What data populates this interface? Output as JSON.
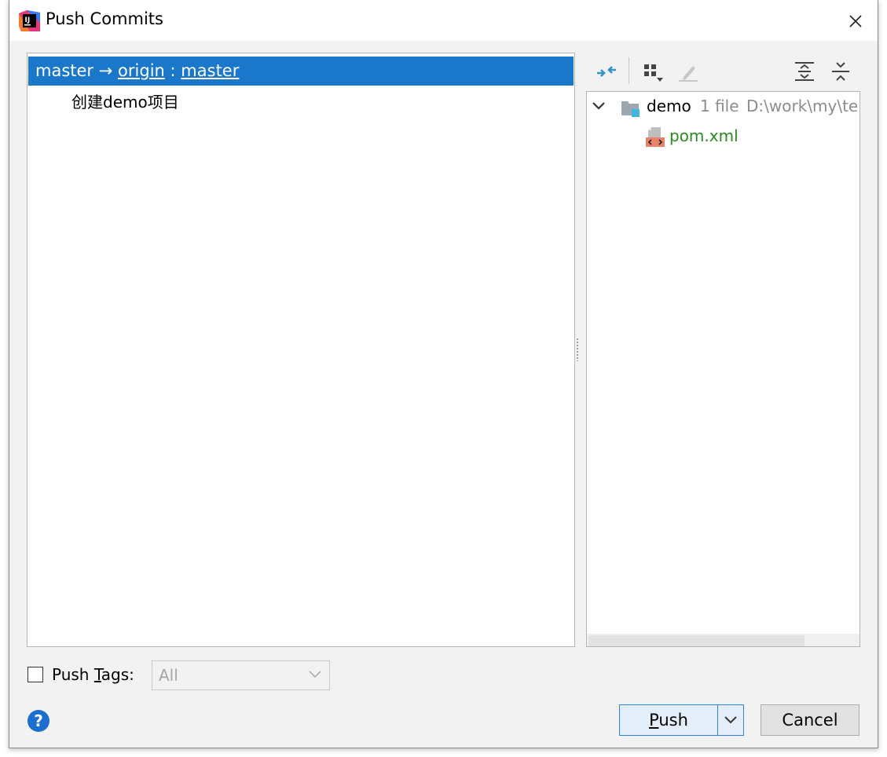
{
  "window": {
    "title": "Push Commits"
  },
  "commits": {
    "branch_local": "master",
    "arrow": "→",
    "remote": "origin",
    "separator": ":",
    "branch_remote": "master",
    "items": [
      {
        "message": "创建demo项目"
      }
    ]
  },
  "changes_tree": {
    "root": {
      "name": "demo",
      "count": "1 file",
      "path": "D:\\work\\my\\te"
    },
    "files": [
      {
        "name": "pom.xml",
        "status_color": "#2a8a1f"
      }
    ]
  },
  "push_tags": {
    "label_before": "Push ",
    "label_mnemonic": "T",
    "label_after": "ags:",
    "checked": false,
    "select_value": "All"
  },
  "buttons": {
    "push": "Push",
    "cancel": "Cancel",
    "help": "?"
  },
  "colors": {
    "selection": "#1a77c9",
    "accent": "#2a84d8",
    "toolbar_icon": "#3592c4"
  }
}
